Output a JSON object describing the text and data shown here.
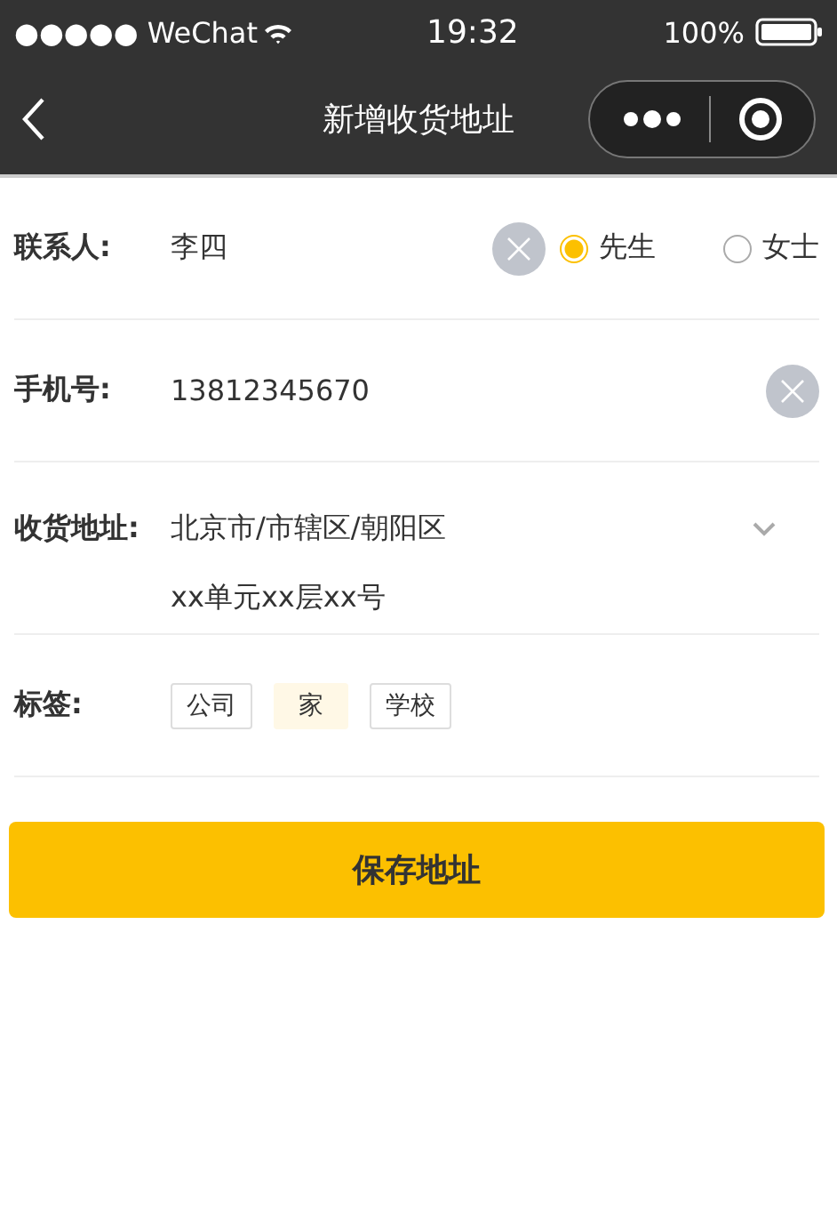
{
  "status_bar": {
    "carrier": "●●●●● WeChat",
    "time": "19:32",
    "battery": "100%"
  },
  "nav_bar": {
    "title": "新增收货地址"
  },
  "contact": {
    "label": "联系人:",
    "value": "李四",
    "genders": [
      {
        "label": "先生",
        "selected": true
      },
      {
        "label": "女士",
        "selected": false
      }
    ]
  },
  "phone": {
    "label": "手机号:",
    "value": "13812345670"
  },
  "address": {
    "label": "收货地址:",
    "region": "北京市/市辖区/朝阳区",
    "detail": "xx单元xx层xx号"
  },
  "tags": {
    "label": "标签:",
    "items": [
      {
        "label": "公司",
        "selected": false
      },
      {
        "label": "家",
        "selected": true
      },
      {
        "label": "学校",
        "selected": false
      }
    ]
  },
  "save_button": "保存地址"
}
